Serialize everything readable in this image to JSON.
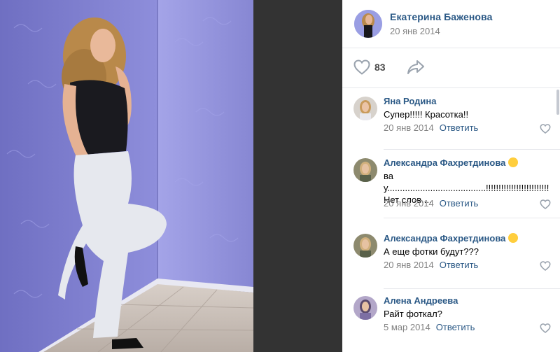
{
  "post": {
    "author_name": "Екатерина Баженова",
    "date": "20 янв 2014",
    "likes": "83"
  },
  "comments": [
    {
      "name": "Яна Родина",
      "text": "Супер!!!!! Красотка!!",
      "date": "20 янв 2014",
      "reply": "Ответить"
    },
    {
      "name": "Александра Фахретдинова",
      "text": "вау.......................................!!!!!!!!!!!!!!!!!!!!!!!!!Нет слов....",
      "date": "20 янв 2014",
      "reply": "Ответить"
    },
    {
      "name": "Александра Фахретдинова",
      "text": "А еще фотки будут???",
      "date": "20 янв 2014",
      "reply": "Ответить"
    },
    {
      "name": "Алена Андреева",
      "text": "Райт фоткал?",
      "date": "5 мар 2014",
      "reply": "Ответить"
    }
  ],
  "icons": {
    "like": "heart-icon",
    "share": "share-arrow-icon",
    "comment_like": "heart-icon",
    "emoji": "smiley-emoji-icon"
  },
  "colors": {
    "link": "#2a5885",
    "meta": "#828282",
    "wall": "#8f8ed6",
    "dark": "#333333"
  }
}
